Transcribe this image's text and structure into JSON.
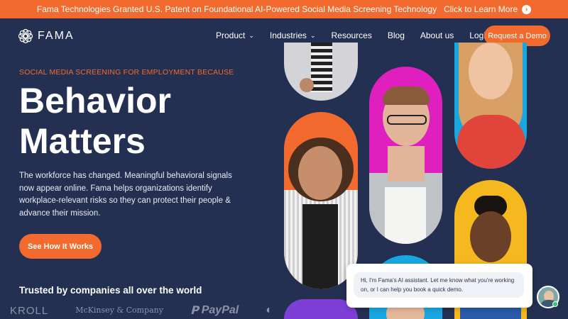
{
  "announcement": {
    "text": "Fama Technologies Granted U.S. Patent on Foundational AI-Powered Social Media Screening Technology",
    "cta": "Click to Learn More",
    "cta_icon": "arrow-right-circle-icon"
  },
  "nav": {
    "logo_text": "FAMA",
    "items": [
      {
        "label": "Product",
        "has_dropdown": true
      },
      {
        "label": "Industries",
        "has_dropdown": true
      },
      {
        "label": "Resources",
        "has_dropdown": false
      },
      {
        "label": "Blog",
        "has_dropdown": false
      },
      {
        "label": "About us",
        "has_dropdown": false
      },
      {
        "label": "Login",
        "has_dropdown": false
      }
    ],
    "demo_button": "Request a Demo"
  },
  "hero": {
    "eyebrow": "SOCIAL MEDIA SCREENING FOR EMPLOYMENT BECAUSE",
    "headline_line1": "Behavior",
    "headline_line2": "Matters",
    "description": "The workforce has changed. Meaningful behavioral signals now appear online. Fama helps organizations identify workplace-relevant risks so they can protect their people & advance their mission.",
    "cta": "See How It Works"
  },
  "trusted": {
    "heading": "Trusted by companies all over the world",
    "logos": [
      "KROLL",
      "McKinsey & Company",
      "PayPal"
    ]
  },
  "chat": {
    "message": "Hi, I'm Fama's AI assistant. Let me know what you're working on, or I can help you book a quick demo."
  },
  "colors": {
    "background": "#233052",
    "accent": "#f26a2d",
    "pill_orange": "#f26a2d",
    "pill_magenta": "#e01fbf",
    "pill_blue": "#19a7e0",
    "pill_yellow": "#f5b81f",
    "pill_purple": "#7d3fd6"
  }
}
